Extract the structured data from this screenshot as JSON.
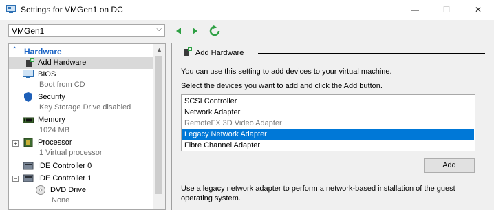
{
  "window": {
    "title": "Settings for VMGen1 on DC",
    "minimize_glyph": "—",
    "maximize_glyph": "☐",
    "close_glyph": "✕"
  },
  "toolbar": {
    "vm_selected": "VMGen1",
    "back_icon": "green-left-arrow-icon",
    "forward_icon": "green-right-arrow-icon",
    "refresh_icon": "green-refresh-icon"
  },
  "tree": {
    "header": "Hardware",
    "items": [
      {
        "label": "Add Hardware",
        "sub": ""
      },
      {
        "label": "BIOS",
        "sub": "Boot from CD"
      },
      {
        "label": "Security",
        "sub": "Key Storage Drive disabled"
      },
      {
        "label": "Memory",
        "sub": "1024 MB"
      },
      {
        "label": "Processor",
        "sub": "1 Virtual processor"
      },
      {
        "label": "IDE Controller 0",
        "sub": ""
      },
      {
        "label": "IDE Controller 1",
        "sub": ""
      },
      {
        "label": "DVD Drive",
        "sub": "None"
      }
    ]
  },
  "panel": {
    "title": "Add Hardware",
    "desc1": "You can use this setting to add devices to your virtual machine.",
    "desc2": "Select the devices you want to add and click the Add button.",
    "devices": [
      "SCSI Controller",
      "Network Adapter",
      "RemoteFX 3D Video Adapter",
      "Legacy Network Adapter",
      "Fibre Channel Adapter"
    ],
    "add_label": "Add",
    "footer": "Use a legacy network adapter to perform a network-based installation of the guest operating system."
  },
  "colors": {
    "selection": "#0078d7",
    "nav_green": "#2ea043"
  }
}
